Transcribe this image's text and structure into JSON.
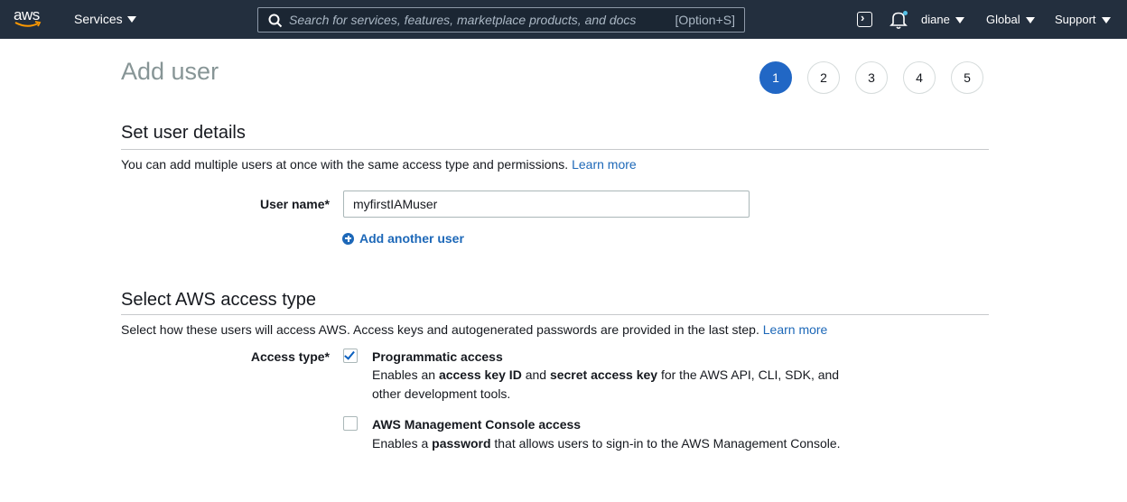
{
  "nav": {
    "logo_text": "aws",
    "services_label": "Services",
    "search_placeholder": "Search for services, features, marketplace products, and docs",
    "search_shortcut": "[Option+S]",
    "user_label": "diane",
    "region_label": "Global",
    "support_label": "Support"
  },
  "page": {
    "title": "Add user",
    "steps": [
      "1",
      "2",
      "3",
      "4",
      "5"
    ],
    "active_step": 1
  },
  "details": {
    "title": "Set user details",
    "description": "You can add multiple users at once with the same access type and permissions.",
    "learn_more": "Learn more",
    "username_label": "User name*",
    "username_value": "myfirstIAMuser",
    "add_another_user": "Add another user"
  },
  "access": {
    "title": "Select AWS access type",
    "description": "Select how these users will access AWS. Access keys and autogenerated passwords are provided in the last step.",
    "learn_more": "Learn more",
    "access_type_label": "Access type*",
    "options": [
      {
        "title": "Programmatic access",
        "checked": true,
        "desc_parts": [
          "Enables an ",
          "access key ID",
          " and ",
          "secret access key",
          " for the AWS API, CLI, SDK, and",
          "other development tools."
        ]
      },
      {
        "title": "AWS Management Console access",
        "checked": false,
        "desc_parts": [
          "Enables a ",
          "password",
          " that allows users to sign-in to the AWS Management Console."
        ]
      }
    ]
  },
  "colors": {
    "nav_bg": "#232f3e",
    "accent": "#2167c5",
    "link": "#1d68b8"
  }
}
